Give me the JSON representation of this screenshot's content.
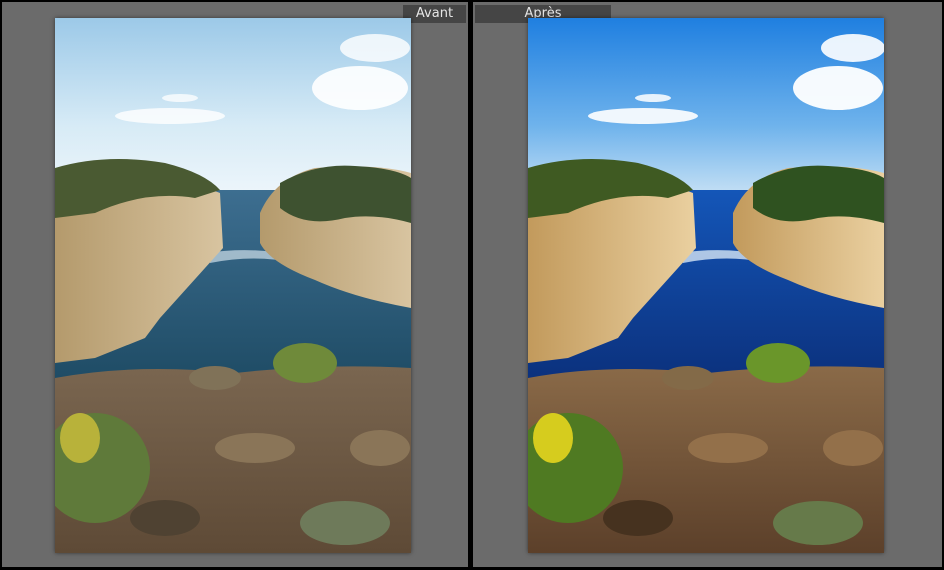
{
  "compare_view": {
    "before": {
      "label": "Avant"
    },
    "after": {
      "label": "Après"
    }
  },
  "colors": {
    "canvas": "#6b6b6b",
    "divider": "#000000",
    "label_bg": "#454545",
    "label_text": "#e6e6e6"
  }
}
